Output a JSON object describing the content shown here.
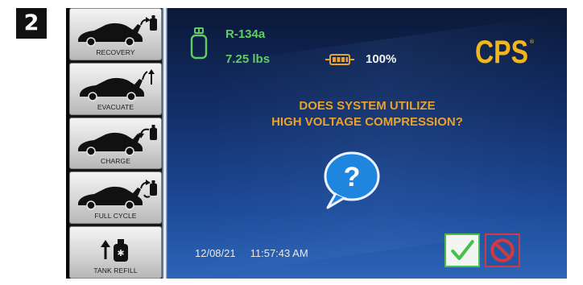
{
  "step_badge": "2",
  "sidebar": {
    "items": [
      {
        "label": "RECOVERY",
        "icon": "car-hood-open-to-tank-icon"
      },
      {
        "label": "EVACUATE",
        "icon": "car-hood-open-vacuum-arrow-icon"
      },
      {
        "label": "CHARGE",
        "icon": "car-hood-open-from-tank-icon"
      },
      {
        "label": "FULL CYCLE",
        "icon": "car-hood-open-cycle-tank-icon"
      },
      {
        "label": "TANK REFILL",
        "icon": "tank-refill-icon"
      }
    ]
  },
  "status": {
    "refrigerant": "R-134a",
    "tank_weight": "7.25 lbs",
    "battery": "100%"
  },
  "brand": {
    "logo_text": "CPS",
    "registered_mark": "®"
  },
  "prompt": {
    "line1": "DOES SYSTEM UTILIZE",
    "line2": "HIGH VOLTAGE COMPRESSION?",
    "bubble_glyph": "?"
  },
  "footer": {
    "date": "12/08/21",
    "time": "11:57:43 AM"
  },
  "colors": {
    "status_green": "#5fcc64",
    "prompt_orange": "#e9a22b",
    "logo_yellow": "#f2b51c",
    "confirm_green": "#47bf4a",
    "cancel_red": "#d13a40"
  }
}
